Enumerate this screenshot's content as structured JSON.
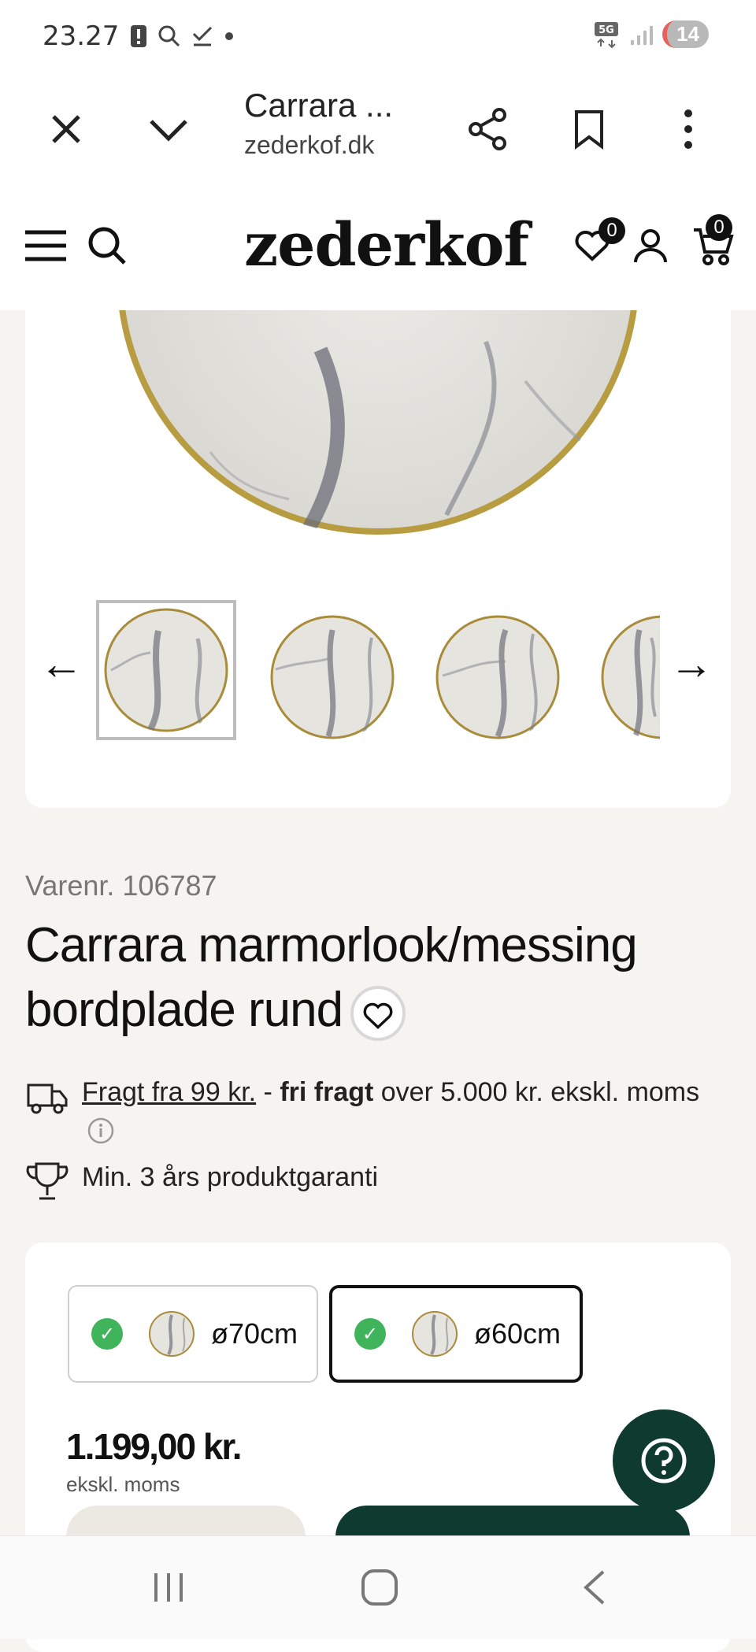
{
  "status_bar": {
    "time": "23.27",
    "network": "5G",
    "notifications_count": "14"
  },
  "browser": {
    "tab_title": "Carrara ...",
    "url": "zederkof.dk"
  },
  "site_header": {
    "logo": "zederkof",
    "wishlist_count": "0",
    "cart_count": "0"
  },
  "gallery": {
    "prev_arrow": "←",
    "next_arrow": "→",
    "thumbnail_count": 4,
    "selected_index": 0
  },
  "product": {
    "sku": "Varenr. 106787",
    "title": "Carrara marmorlook/messing bordplade rund",
    "shipping_link": "Fragt fra 99 kr.",
    "shipping_sep": " - ",
    "shipping_bold": "fri fragt",
    "shipping_rest": " over 5.000 kr. ekskl. moms",
    "warranty": "Min. 3 års produktgaranti"
  },
  "variants": [
    {
      "label": "ø70cm",
      "available": true,
      "selected": false
    },
    {
      "label": "ø60cm",
      "available": true,
      "selected": true
    }
  ],
  "pricing": {
    "price": "1.199,00 kr.",
    "note": "ekskl. moms"
  },
  "colors": {
    "brand_green": "#0e3a2f",
    "check_green": "#3fb45a",
    "page_bg": "#f5f4f1"
  }
}
